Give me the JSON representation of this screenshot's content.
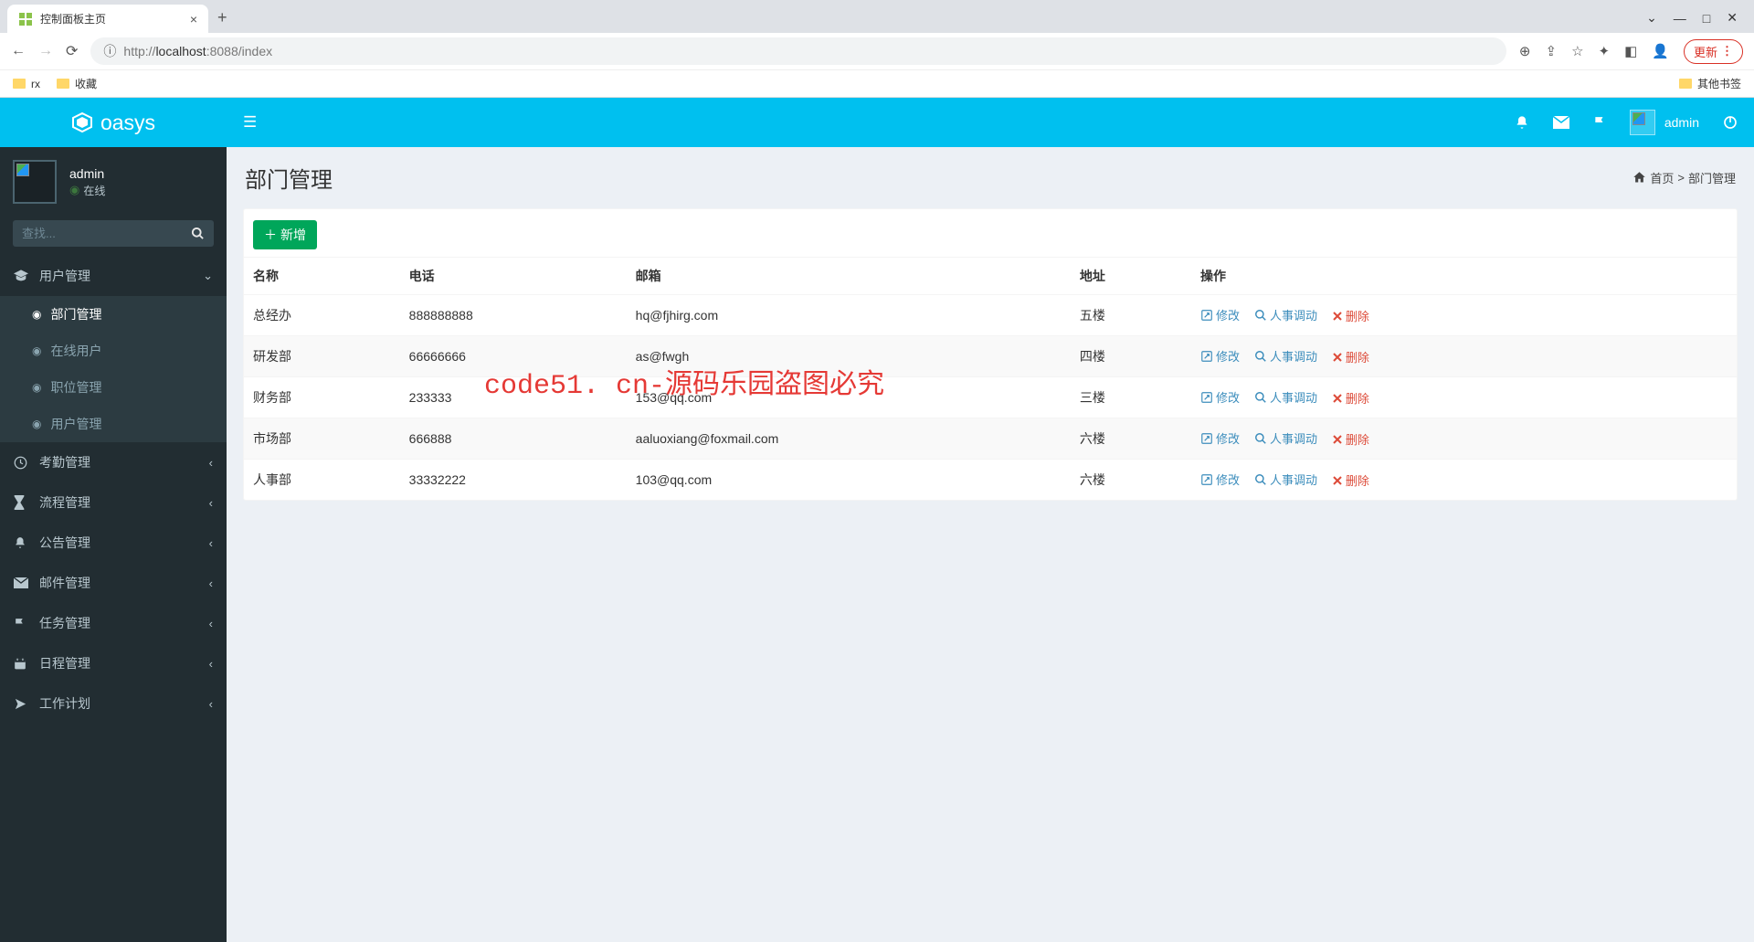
{
  "browser": {
    "tab_title": "控制面板主页",
    "url_host": "localhost",
    "url_port": ":8088",
    "url_path": "/index",
    "update_label": "更新",
    "bookmarks": [
      "rx",
      "收藏"
    ],
    "other_bookmarks": "其他书签"
  },
  "app": {
    "brand": "oasys",
    "user": {
      "name": "admin",
      "status": "在线"
    },
    "search_placeholder": "查找...",
    "topbar_user": "admin"
  },
  "sidebar": {
    "items": [
      {
        "icon": "graduation",
        "label": "用户管理",
        "expanded": true,
        "children": [
          {
            "label": "部门管理",
            "active": true
          },
          {
            "label": "在线用户"
          },
          {
            "label": "职位管理"
          },
          {
            "label": "用户管理"
          }
        ]
      },
      {
        "icon": "clock",
        "label": "考勤管理"
      },
      {
        "icon": "hourglass",
        "label": "流程管理"
      },
      {
        "icon": "bell",
        "label": "公告管理"
      },
      {
        "icon": "envelope",
        "label": "邮件管理"
      },
      {
        "icon": "flag",
        "label": "任务管理"
      },
      {
        "icon": "calendar",
        "label": "日程管理"
      },
      {
        "icon": "plane",
        "label": "工作计划"
      }
    ]
  },
  "page": {
    "title": "部门管理",
    "breadcrumb": {
      "home": "首页",
      "sep": ">",
      "current": "部门管理"
    },
    "add_btn": "新增"
  },
  "table": {
    "headers": [
      "名称",
      "电话",
      "邮箱",
      "地址",
      "操作"
    ],
    "rows": [
      {
        "name": "总经办",
        "tel": "888888888",
        "email": "hq@fjhirg.com",
        "addr": "五楼"
      },
      {
        "name": "研发部",
        "tel": "66666666",
        "email": "as@fwgh",
        "addr": "四楼"
      },
      {
        "name": "财务部",
        "tel": "233333",
        "email": "153@qq.com",
        "addr": "三楼"
      },
      {
        "name": "市场部",
        "tel": "666888",
        "email": "aaluoxiang@foxmail.com",
        "addr": "六楼"
      },
      {
        "name": "人事部",
        "tel": "33332222",
        "email": "103@qq.com",
        "addr": "六楼"
      }
    ],
    "actions": {
      "edit": "修改",
      "transfer": "人事调动",
      "delete": "删除"
    }
  },
  "watermark": "code51. cn-源码乐园盗图必究"
}
